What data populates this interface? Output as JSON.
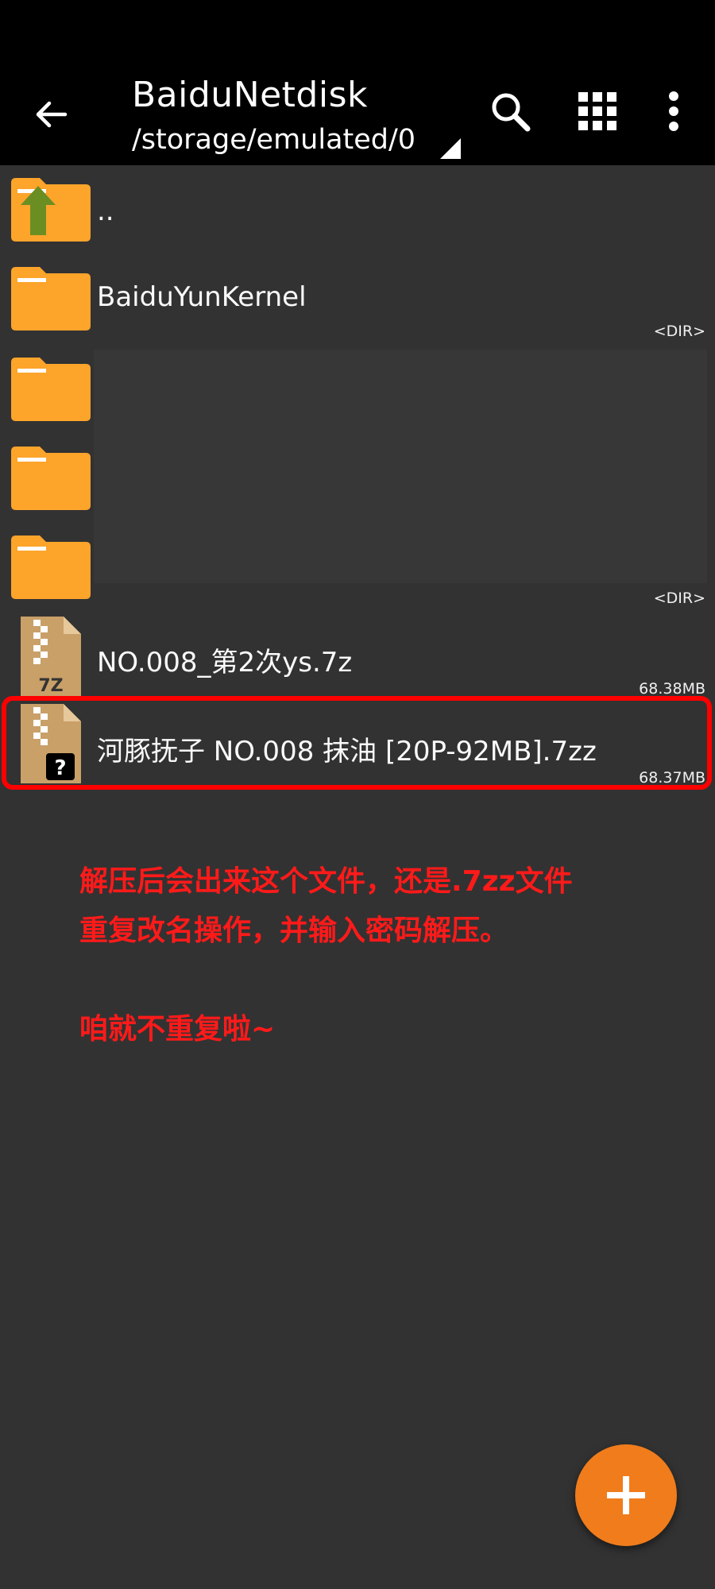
{
  "app_bar": {
    "title": "BaiduNetdisk",
    "path": "/storage/emulated/0"
  },
  "files": [
    {
      "name": "..",
      "meta": "",
      "kind": "parent-folder"
    },
    {
      "name": "BaiduYunKernel",
      "meta": "<DIR>",
      "kind": "folder"
    },
    {
      "name": "",
      "meta": "",
      "kind": "folder"
    },
    {
      "name": "",
      "meta": "",
      "kind": "folder"
    },
    {
      "name": "",
      "meta": "<DIR>",
      "kind": "folder"
    },
    {
      "name": "NO.008_第2次ys.7z",
      "meta": "68.38MB",
      "kind": "7z-archive"
    },
    {
      "name": "河豚抚子 NO.008 抹油 [20P-92MB].7zz",
      "meta": "68.37MB",
      "kind": "unknown-archive"
    }
  ],
  "annotation": {
    "line1": "解压后会出来这个文件，还是.7zz文件",
    "line2": "重复改名操作，并输入密码解压。",
    "line3": "咱就不重复啦~",
    "color": "#ff1a1a"
  },
  "colors": {
    "folder": "#fda42b",
    "fab": "#f07c1c",
    "highlight": "#ff0000"
  }
}
